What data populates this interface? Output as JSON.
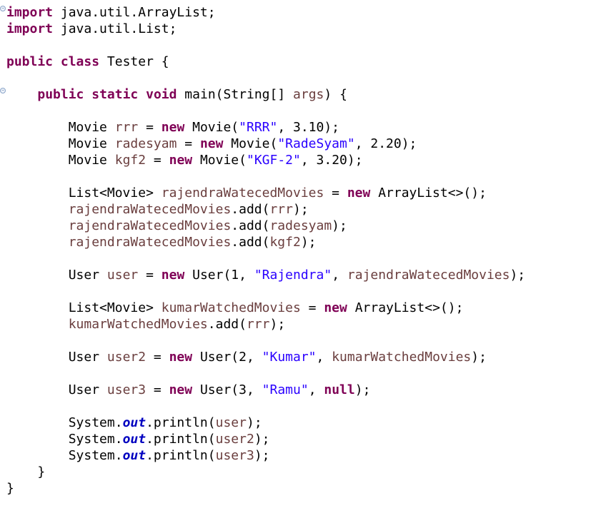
{
  "editor": {
    "fold_marker_glyph": "−",
    "lines": [
      {
        "indent": "",
        "tokens": [
          {
            "t": "kw",
            "v": "import"
          },
          {
            "t": "plain",
            "v": " java.util.ArrayList;"
          }
        ]
      },
      {
        "indent": "",
        "tokens": [
          {
            "t": "kw",
            "v": "import"
          },
          {
            "t": "plain",
            "v": " java.util.List;"
          }
        ]
      },
      {
        "indent": "",
        "tokens": []
      },
      {
        "indent": "",
        "tokens": [
          {
            "t": "kw",
            "v": "public"
          },
          {
            "t": "plain",
            "v": " "
          },
          {
            "t": "kw",
            "v": "class"
          },
          {
            "t": "plain",
            "v": " Tester {"
          }
        ]
      },
      {
        "indent": "",
        "tokens": []
      },
      {
        "indent": "    ",
        "tokens": [
          {
            "t": "kw",
            "v": "public"
          },
          {
            "t": "plain",
            "v": " "
          },
          {
            "t": "kw",
            "v": "static"
          },
          {
            "t": "plain",
            "v": " "
          },
          {
            "t": "kw",
            "v": "void"
          },
          {
            "t": "plain",
            "v": " main(String[] "
          },
          {
            "t": "var",
            "v": "args"
          },
          {
            "t": "plain",
            "v": ") {"
          }
        ]
      },
      {
        "indent": "",
        "tokens": []
      },
      {
        "indent": "        ",
        "tokens": [
          {
            "t": "plain",
            "v": "Movie "
          },
          {
            "t": "var",
            "v": "rrr"
          },
          {
            "t": "plain",
            "v": " = "
          },
          {
            "t": "kw",
            "v": "new"
          },
          {
            "t": "plain",
            "v": " Movie("
          },
          {
            "t": "str",
            "v": "\"RRR\""
          },
          {
            "t": "plain",
            "v": ", 3.10);"
          }
        ]
      },
      {
        "indent": "        ",
        "tokens": [
          {
            "t": "plain",
            "v": "Movie "
          },
          {
            "t": "var",
            "v": "radesyam"
          },
          {
            "t": "plain",
            "v": " = "
          },
          {
            "t": "kw",
            "v": "new"
          },
          {
            "t": "plain",
            "v": " Movie("
          },
          {
            "t": "str",
            "v": "\"RadeSyam\""
          },
          {
            "t": "plain",
            "v": ", 2.20);"
          }
        ]
      },
      {
        "indent": "        ",
        "tokens": [
          {
            "t": "plain",
            "v": "Movie "
          },
          {
            "t": "var",
            "v": "kgf2"
          },
          {
            "t": "plain",
            "v": " = "
          },
          {
            "t": "kw",
            "v": "new"
          },
          {
            "t": "plain",
            "v": " Movie("
          },
          {
            "t": "str",
            "v": "\"KGF-2\""
          },
          {
            "t": "plain",
            "v": ", 3.20);"
          }
        ]
      },
      {
        "indent": "",
        "tokens": []
      },
      {
        "indent": "        ",
        "tokens": [
          {
            "t": "plain",
            "v": "List<Movie> "
          },
          {
            "t": "var",
            "v": "rajendraWatecedMovies"
          },
          {
            "t": "plain",
            "v": " = "
          },
          {
            "t": "kw",
            "v": "new"
          },
          {
            "t": "plain",
            "v": " ArrayList<>();"
          }
        ]
      },
      {
        "indent": "        ",
        "tokens": [
          {
            "t": "var",
            "v": "rajendraWatecedMovies"
          },
          {
            "t": "plain",
            "v": ".add("
          },
          {
            "t": "var",
            "v": "rrr"
          },
          {
            "t": "plain",
            "v": ");"
          }
        ]
      },
      {
        "indent": "        ",
        "tokens": [
          {
            "t": "var",
            "v": "rajendraWatecedMovies"
          },
          {
            "t": "plain",
            "v": ".add("
          },
          {
            "t": "var",
            "v": "radesyam"
          },
          {
            "t": "plain",
            "v": ");"
          }
        ]
      },
      {
        "indent": "        ",
        "tokens": [
          {
            "t": "var",
            "v": "rajendraWatecedMovies"
          },
          {
            "t": "plain",
            "v": ".add("
          },
          {
            "t": "var",
            "v": "kgf2"
          },
          {
            "t": "plain",
            "v": ");"
          }
        ]
      },
      {
        "indent": "",
        "tokens": []
      },
      {
        "indent": "        ",
        "tokens": [
          {
            "t": "plain",
            "v": "User "
          },
          {
            "t": "var",
            "v": "user"
          },
          {
            "t": "plain",
            "v": " = "
          },
          {
            "t": "kw",
            "v": "new"
          },
          {
            "t": "plain",
            "v": " User(1, "
          },
          {
            "t": "str",
            "v": "\"Rajendra\""
          },
          {
            "t": "plain",
            "v": ", "
          },
          {
            "t": "var",
            "v": "rajendraWatecedMovies"
          },
          {
            "t": "plain",
            "v": ");"
          }
        ]
      },
      {
        "indent": "",
        "tokens": []
      },
      {
        "indent": "        ",
        "tokens": [
          {
            "t": "plain",
            "v": "List<Movie> "
          },
          {
            "t": "var",
            "v": "kumarWatchedMovies"
          },
          {
            "t": "plain",
            "v": " = "
          },
          {
            "t": "kw",
            "v": "new"
          },
          {
            "t": "plain",
            "v": " ArrayList<>();"
          }
        ]
      },
      {
        "indent": "        ",
        "tokens": [
          {
            "t": "var",
            "v": "kumarWatchedMovies"
          },
          {
            "t": "plain",
            "v": ".add("
          },
          {
            "t": "var",
            "v": "rrr"
          },
          {
            "t": "plain",
            "v": ");"
          }
        ]
      },
      {
        "indent": "",
        "tokens": []
      },
      {
        "indent": "        ",
        "tokens": [
          {
            "t": "plain",
            "v": "User "
          },
          {
            "t": "var",
            "v": "user2"
          },
          {
            "t": "plain",
            "v": " = "
          },
          {
            "t": "kw",
            "v": "new"
          },
          {
            "t": "plain",
            "v": " User(2, "
          },
          {
            "t": "str",
            "v": "\"Kumar\""
          },
          {
            "t": "plain",
            "v": ", "
          },
          {
            "t": "var",
            "v": "kumarWatchedMovies"
          },
          {
            "t": "plain",
            "v": ");"
          }
        ]
      },
      {
        "indent": "",
        "tokens": []
      },
      {
        "indent": "        ",
        "tokens": [
          {
            "t": "plain",
            "v": "User "
          },
          {
            "t": "var",
            "v": "user3"
          },
          {
            "t": "plain",
            "v": " = "
          },
          {
            "t": "kw",
            "v": "new"
          },
          {
            "t": "plain",
            "v": " User(3, "
          },
          {
            "t": "str",
            "v": "\"Ramu\""
          },
          {
            "t": "plain",
            "v": ", "
          },
          {
            "t": "kw",
            "v": "null"
          },
          {
            "t": "plain",
            "v": ");"
          }
        ]
      },
      {
        "indent": "",
        "tokens": []
      },
      {
        "indent": "        ",
        "tokens": [
          {
            "t": "plain",
            "v": "System."
          },
          {
            "t": "fld",
            "v": "out"
          },
          {
            "t": "plain",
            "v": ".println("
          },
          {
            "t": "var",
            "v": "user"
          },
          {
            "t": "plain",
            "v": ");"
          }
        ]
      },
      {
        "indent": "        ",
        "tokens": [
          {
            "t": "plain",
            "v": "System."
          },
          {
            "t": "fld",
            "v": "out"
          },
          {
            "t": "plain",
            "v": ".println("
          },
          {
            "t": "var",
            "v": "user2"
          },
          {
            "t": "plain",
            "v": ");"
          }
        ]
      },
      {
        "indent": "        ",
        "tokens": [
          {
            "t": "plain",
            "v": "System."
          },
          {
            "t": "fld",
            "v": "out"
          },
          {
            "t": "plain",
            "v": ".println("
          },
          {
            "t": "var",
            "v": "user3"
          },
          {
            "t": "plain",
            "v": ");"
          }
        ]
      },
      {
        "indent": "    ",
        "tokens": [
          {
            "t": "plain",
            "v": "}"
          }
        ]
      },
      {
        "indent": "",
        "tokens": [
          {
            "t": "plain",
            "v": "}"
          }
        ]
      }
    ],
    "fold_markers_at_lines": [
      0,
      5
    ]
  },
  "colors": {
    "keyword": "#7f0055",
    "string": "#2a00ff",
    "variable": "#6a3e3e",
    "static_field": "#0000c0",
    "plain": "#000000",
    "background": "#ffffff"
  }
}
